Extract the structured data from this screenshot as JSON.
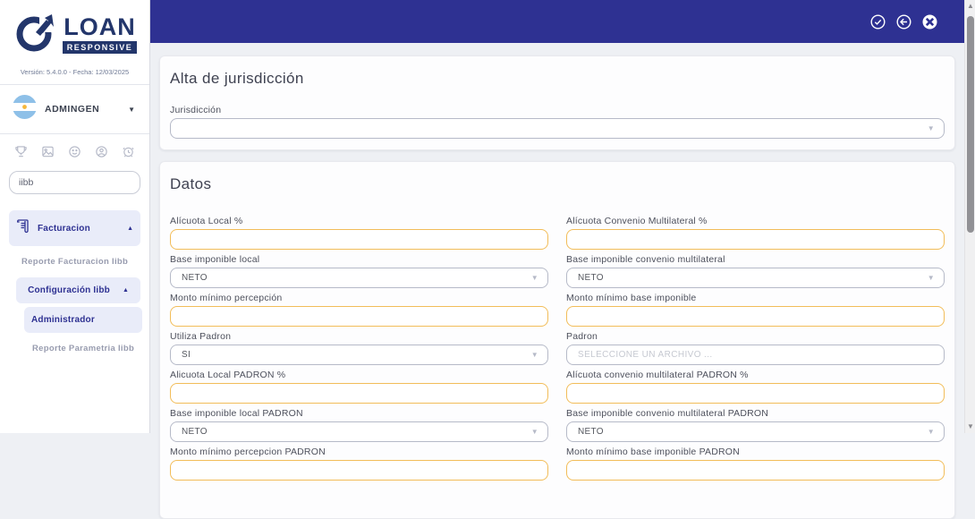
{
  "sidebar": {
    "logo": {
      "title": "LOAN",
      "subtitle": "RESPONSIVE"
    },
    "version": "Versión: 5.4.0.0 - Fecha: 12/03/2025",
    "user": {
      "name": "ADMINGEN"
    },
    "search": {
      "value": "iibb"
    },
    "menu": {
      "facturacion": "Facturacion",
      "reporte_facturacion": "Reporte Facturacion Iibb",
      "configuracion": "Configuración Iibb",
      "administrador": "Administrador",
      "reporte_parametria": "Reporte Parametria Iibb"
    }
  },
  "main": {
    "jurisdiccion": {
      "title": "Alta de jurisdicción",
      "label": "Jurisdicción",
      "value": ""
    },
    "datos": {
      "title": "Datos",
      "fields": [
        {
          "label": "Alícuota Local %",
          "value": ""
        },
        {
          "label": "Alícuota Convenio Multilateral %",
          "value": ""
        },
        {
          "label": "Base imponible local",
          "value": "NETO"
        },
        {
          "label": "Base imponible convenio multilateral",
          "value": "NETO"
        },
        {
          "label": "Monto mínimo percepción",
          "value": ""
        },
        {
          "label": "Monto mínimo base imponible",
          "value": ""
        },
        {
          "label": "Utiliza Padron",
          "value": "SI"
        },
        {
          "label": "Padron",
          "value": "",
          "placeholder": "SELECCIONE UN ARCHIVO ..."
        },
        {
          "label": "Alicuota Local PADRON %",
          "value": ""
        },
        {
          "label": "Alícuota convenio multilateral PADRON %",
          "value": ""
        },
        {
          "label": "Base imponible local PADRON",
          "value": "NETO"
        },
        {
          "label": "Base imponible convenio multilateral PADRON",
          "value": "NETO"
        },
        {
          "label": "Monto mínimo percepcion PADRON",
          "value": ""
        },
        {
          "label": "Monto mínimo base imponible PADRON",
          "value": ""
        }
      ]
    }
  },
  "colors": {
    "header_navy": "#2e3192",
    "logo_navy": "#23366b",
    "accent_orange": "#f2bd59",
    "menu_active_bg": "#e9ecf9",
    "page_bg": "#eef0f4"
  }
}
